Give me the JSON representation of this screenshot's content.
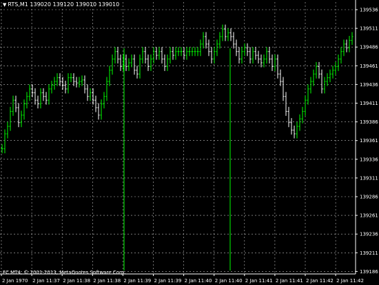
{
  "header": {
    "symbol_line": "RTS,M1  139020 139120 139010 139010"
  },
  "copyright": "FC MT4, © 2001-2013, MetaQuotes Software Corp.",
  "colors": {
    "background": "#000000",
    "grid": "#c0c0c0",
    "bar_up": "#00ff00",
    "bar_down": "#ffffff",
    "text": "#ffffff"
  },
  "chart_data": {
    "type": "bar",
    "title": "",
    "y_ticks": [
      "139536",
      "139511",
      "139486",
      "139461",
      "139436",
      "139411",
      "139386",
      "139361",
      "139336",
      "139311",
      "139286",
      "139261",
      "139236",
      "139211",
      "139186"
    ],
    "ylim": [
      139186,
      139536
    ],
    "x_ticks": [
      "2 Jan 1970",
      "2 Jan 11:37",
      "2 Jan 11:38",
      "2 Jan 11:38",
      "2 Jan 11:39",
      "2 Jan 11:39",
      "2 Jan 11:40",
      "2 Jan 11:40",
      "2 Jan 11:41",
      "2 Jan 11:41",
      "2 Jan 11:42",
      "2 Jan 11:42"
    ],
    "grid": true,
    "closes": [
      139350,
      139370,
      139380,
      139400,
      139415,
      139405,
      139385,
      139395,
      139410,
      139420,
      139430,
      139425,
      139415,
      139410,
      139425,
      139420,
      139415,
      139430,
      139435,
      139440,
      139445,
      139440,
      139435,
      139430,
      139445,
      139445,
      139440,
      139438,
      139440,
      139442,
      139430,
      139420,
      139425,
      139415,
      139405,
      139395,
      139410,
      139420,
      139440,
      139455,
      139470,
      139480,
      139470,
      139460,
      139470,
      139460,
      139465,
      139470,
      139455,
      139450,
      139470,
      139480,
      139470,
      139460,
      139470,
      139480,
      139475,
      139480,
      139470,
      139460,
      139470,
      139480,
      139475,
      139480,
      139480,
      139480,
      139475,
      139480,
      139480,
      139480,
      139480,
      139480,
      139490,
      139500,
      139490,
      139480,
      139470,
      139480,
      139490,
      139500,
      139510,
      139500,
      139505,
      139500,
      139490,
      139480,
      139470,
      139480,
      139485,
      139480,
      139470,
      139480,
      139475,
      139470,
      139465,
      139470,
      139480,
      139470,
      139460,
      139470,
      139450,
      139440,
      139420,
      139400,
      139385,
      139375,
      139370,
      139380,
      139390,
      139400,
      139415,
      139430,
      139440,
      139450,
      139460,
      139450,
      139430,
      139440,
      139445,
      139450,
      139455,
      139460,
      139470,
      139480,
      139490,
      139485,
      139495,
      139500
    ]
  }
}
